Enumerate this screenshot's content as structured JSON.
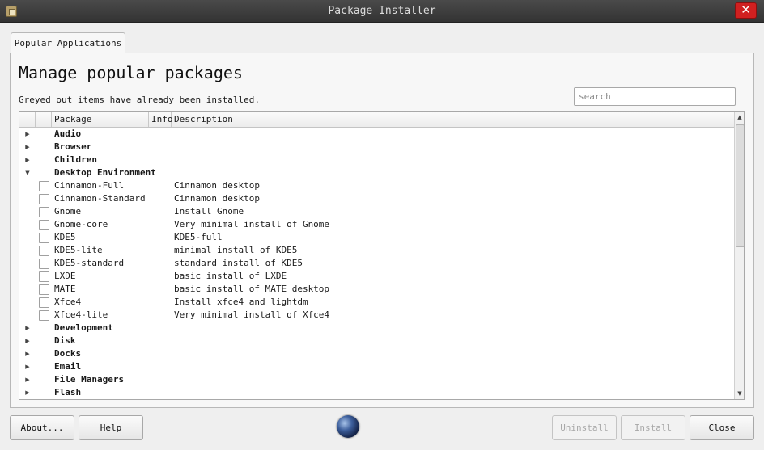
{
  "window": {
    "title": "Package Installer",
    "close_glyph": "✕"
  },
  "tabs": [
    {
      "label": "Popular Applications"
    }
  ],
  "header": {
    "title": "Manage popular packages",
    "subtitle": "Greyed out items have already been installed."
  },
  "search": {
    "placeholder": "search",
    "value": ""
  },
  "tree": {
    "columns": {
      "package": "Package",
      "info": "Info",
      "description": "Description"
    },
    "top_categories": [
      {
        "label": "Audio",
        "expanded": false
      },
      {
        "label": "Browser",
        "expanded": false
      },
      {
        "label": "Children",
        "expanded": false
      },
      {
        "label": "Desktop Environment",
        "expanded": true
      }
    ],
    "packages": [
      {
        "name": "Cinnamon-Full",
        "description": "Cinnamon desktop",
        "checked": false
      },
      {
        "name": "Cinnamon-Standard",
        "description": "Cinnamon desktop",
        "checked": false
      },
      {
        "name": "Gnome",
        "description": "Install Gnome",
        "checked": false
      },
      {
        "name": "Gnome-core",
        "description": "Very minimal install of Gnome",
        "checked": false
      },
      {
        "name": "KDE5",
        "description": "KDE5-full",
        "checked": false
      },
      {
        "name": "KDE5-lite",
        "description": "minimal install of KDE5",
        "checked": false
      },
      {
        "name": "KDE5-standard",
        "description": "standard install of KDE5",
        "checked": false
      },
      {
        "name": "LXDE",
        "description": "basic install of LXDE",
        "checked": false
      },
      {
        "name": "MATE",
        "description": "basic install of MATE desktop",
        "checked": false
      },
      {
        "name": "Xfce4",
        "description": "Install xfce4 and lightdm",
        "checked": false
      },
      {
        "name": "Xfce4-lite",
        "description": "Very minimal install of Xfce4",
        "checked": false
      }
    ],
    "bottom_categories": [
      {
        "label": "Development",
        "expanded": false
      },
      {
        "label": "Disk",
        "expanded": false
      },
      {
        "label": "Docks",
        "expanded": false
      },
      {
        "label": "Email",
        "expanded": false
      },
      {
        "label": "File Managers",
        "expanded": false
      },
      {
        "label": "Flash",
        "expanded": false
      }
    ],
    "glyphs": {
      "collapsed": "▶",
      "expanded": "▼",
      "scroll_up": "▲",
      "scroll_down": "▼"
    }
  },
  "buttons": {
    "about": "About...",
    "help": "Help",
    "uninstall": "Uninstall",
    "install": "Install",
    "close": "Close"
  },
  "colors": {
    "titlebar": "#333333",
    "close_button": "#d02020",
    "background": "#efefef"
  }
}
